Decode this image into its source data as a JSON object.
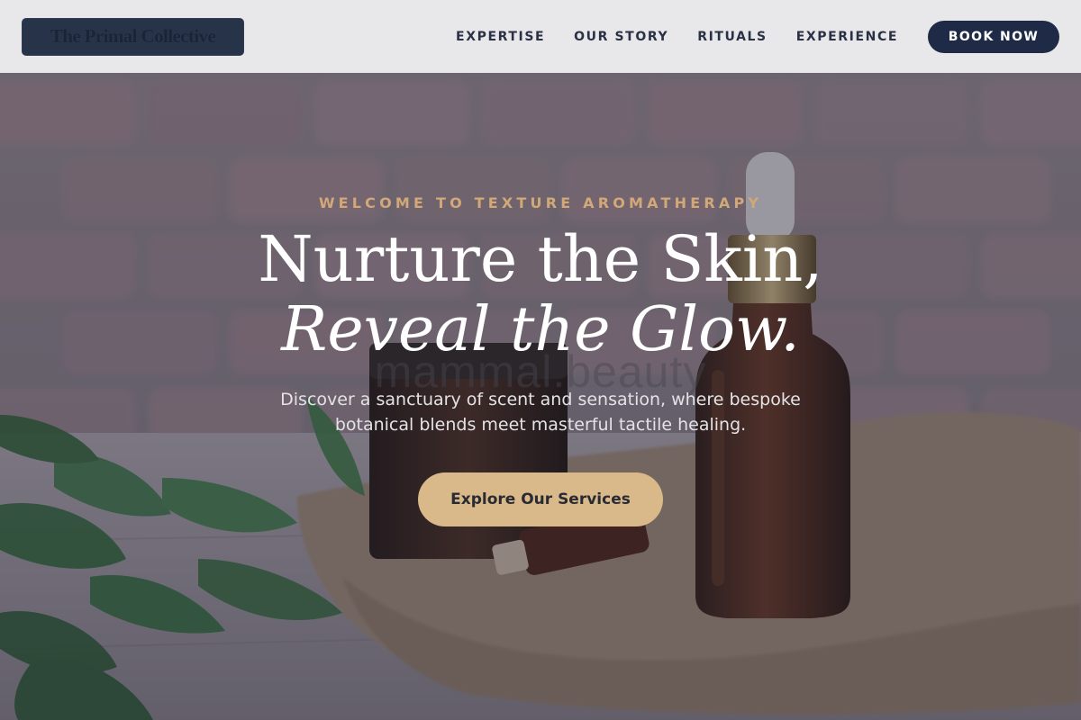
{
  "header": {
    "logo_text": "The Primal Collective",
    "nav": [
      {
        "label": "EXPERTISE"
      },
      {
        "label": "OUR STORY"
      },
      {
        "label": "RITUALS"
      },
      {
        "label": "EXPERIENCE"
      }
    ],
    "book_label": "BOOK NOW"
  },
  "hero": {
    "eyebrow": "WELCOME TO TEXTURE AROMATHERAPY",
    "headline_line1": "Nurture the Skin,",
    "headline_line2": "Reveal the Glow.",
    "watermark": "mammal.beauty",
    "subtext": "Discover a sanctuary of scent and sensation, where bespoke botanical blends meet masterful tactile healing.",
    "cta_label": "Explore Our Services"
  },
  "colors": {
    "header_bg": "#e8e8ea",
    "navy": "#1f2b46",
    "accent_gold": "#d2a878",
    "cta_bg": "#d9b98a"
  }
}
